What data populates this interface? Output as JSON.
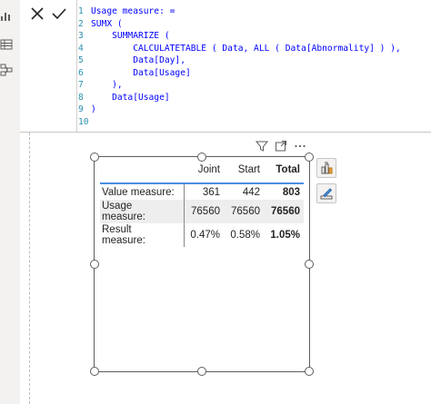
{
  "formula_bar": {
    "cancel_icon": "close-icon",
    "commit_icon": "check-icon",
    "lines": [
      {
        "n": "1",
        "text": "Usage measure: ="
      },
      {
        "n": "2",
        "text": "SUMX ("
      },
      {
        "n": "3",
        "text": "    SUMMARIZE ("
      },
      {
        "n": "4",
        "text": "        CALCULATETABLE ( Data, ALL ( Data[Abnormality] ) ),"
      },
      {
        "n": "5",
        "text": "        Data[Day],"
      },
      {
        "n": "6",
        "text": "        Data[Usage]"
      },
      {
        "n": "7",
        "text": "    ),"
      },
      {
        "n": "8",
        "text": "    Data[Usage]"
      },
      {
        "n": "9",
        "text": ")"
      },
      {
        "n": "10",
        "text": ""
      }
    ]
  },
  "left_rail": {
    "icons": [
      "report-view-icon",
      "table-view-icon",
      "model-view-icon"
    ]
  },
  "visual_header": {
    "icons": [
      "filter-icon",
      "focus-mode-icon",
      "more-options-icon"
    ]
  },
  "side_panel": {
    "icons": [
      "build-visual-icon",
      "format-visual-icon"
    ]
  },
  "matrix": {
    "columns": [
      "",
      "Joint",
      "Start",
      "Total"
    ],
    "rows": [
      {
        "label": "Value measure:",
        "joint": "361",
        "start": "442",
        "total": "803"
      },
      {
        "label": "Usage measure:",
        "joint": "76560",
        "start": "76560",
        "total": "76560"
      },
      {
        "label": "Result measure:",
        "joint": "0.47%",
        "start": "0.58%",
        "total": "1.05%"
      }
    ]
  },
  "colors": {
    "accent": "#4a90e2",
    "code": "#0000ff",
    "line_numbers": "#2b91af"
  }
}
